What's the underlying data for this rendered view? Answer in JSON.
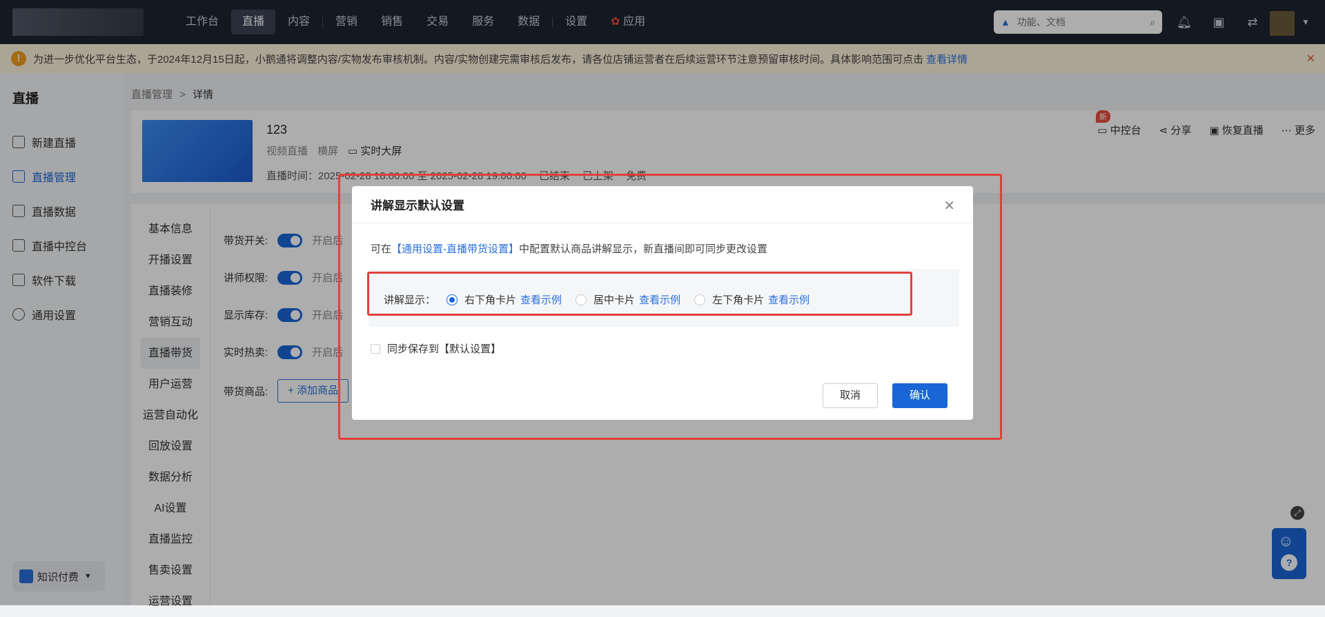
{
  "topnav": {
    "menu": [
      "工作台",
      "直播",
      "内容",
      "营销",
      "销售",
      "交易",
      "服务",
      "数据",
      "设置",
      "应用"
    ],
    "search_placeholder": "功能、文档"
  },
  "notice": {
    "text": "为进一步优化平台生态，于2024年12月15日起，小鹅通将调整内容/实物发布审核机制。内容/实物创建完需审核后发布，请各位店铺运营者在后续运营环节注意预留审核时间。具体影响范围可点击",
    "link": "查看详情"
  },
  "sidebar": {
    "title": "直播",
    "items": [
      "新建直播",
      "直播管理",
      "直播数据",
      "直播中控台",
      "软件下载",
      "通用设置"
    ],
    "footer": "知识付费"
  },
  "breadcrumb": {
    "parent": "直播管理",
    "sep": ">",
    "current": "详情"
  },
  "live": {
    "title": "123",
    "type": "视频直播",
    "orientation": "横屏",
    "screen": "实时大屏",
    "time": "直播时间：2025-02-28 18:00:00 至 2025-02-28 19:00:00",
    "status": "已结束",
    "shelf": "已上架",
    "price": "免费",
    "actions": [
      "中控台",
      "分享",
      "恢复直播",
      "更多"
    ],
    "new_badge": "新"
  },
  "leftmenu": [
    "基本信息",
    "开播设置",
    "直播装修",
    "营销互动",
    "直播带货",
    "用户运营",
    "运营自动化",
    "回放设置",
    "数据分析",
    "AI设置",
    "直播监控",
    "售卖设置",
    "运营设置"
  ],
  "form": {
    "rows": [
      "带货开关:",
      "讲师权限:",
      "显示库存:",
      "实时热卖:"
    ],
    "ext": "开启后",
    "goods_label": "带货商品:",
    "add_btn": "+ 添加商品"
  },
  "dialog": {
    "title": "讲解显示默认设置",
    "desc_pre": "可在",
    "desc_link": "【通用设置-直播带货设置】",
    "desc_post": "中配置默认商品讲解显示，新直播间即可同步更改设置",
    "label": "讲解显示：",
    "options": [
      "右下角卡片",
      "居中卡片",
      "左下角卡片"
    ],
    "example": "查看示例",
    "checkbox": "同步保存到【默认设置】",
    "cancel": "取消",
    "ok": "确认"
  }
}
